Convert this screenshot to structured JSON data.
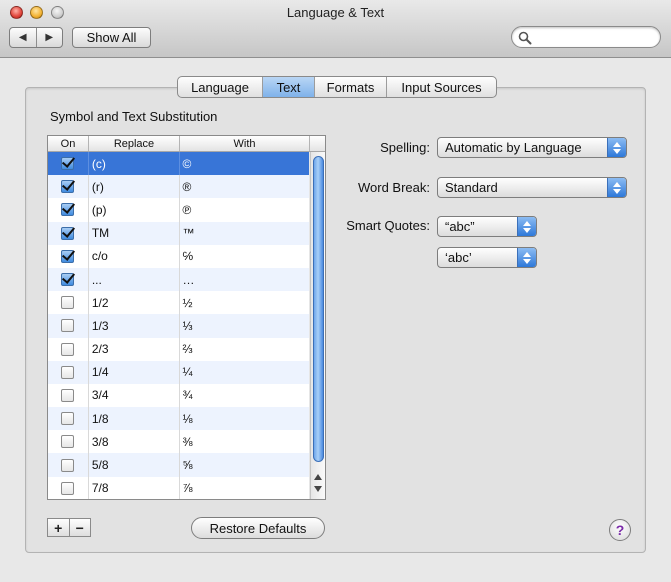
{
  "window": {
    "title": "Language & Text"
  },
  "toolbar": {
    "back_icon": "◀",
    "forward_icon": "▶",
    "show_all": "Show All",
    "search_placeholder": ""
  },
  "tabs": [
    {
      "label": "Language",
      "active": false
    },
    {
      "label": "Text",
      "active": true
    },
    {
      "label": "Formats",
      "active": false
    },
    {
      "label": "Input Sources",
      "active": false
    }
  ],
  "substitution": {
    "title": "Symbol and Text Substitution",
    "columns": {
      "on": "On",
      "replace": "Replace",
      "with": "With"
    },
    "rows": [
      {
        "on": true,
        "replace": "(c)",
        "with": "©",
        "selected": true
      },
      {
        "on": true,
        "replace": "(r)",
        "with": "®"
      },
      {
        "on": true,
        "replace": "(p)",
        "with": "℗"
      },
      {
        "on": true,
        "replace": "TM",
        "with": "™"
      },
      {
        "on": true,
        "replace": "c/o",
        "with": "℅"
      },
      {
        "on": true,
        "replace": "...",
        "with": "…"
      },
      {
        "on": false,
        "replace": "1/2",
        "with": "½"
      },
      {
        "on": false,
        "replace": "1/3",
        "with": "⅓"
      },
      {
        "on": false,
        "replace": "2/3",
        "with": "⅔"
      },
      {
        "on": false,
        "replace": "1/4",
        "with": "¼"
      },
      {
        "on": false,
        "replace": "3/4",
        "with": "¾"
      },
      {
        "on": false,
        "replace": "1/8",
        "with": "⅛"
      },
      {
        "on": false,
        "replace": "3/8",
        "with": "⅜"
      },
      {
        "on": false,
        "replace": "5/8",
        "with": "⅝"
      },
      {
        "on": false,
        "replace": "7/8",
        "with": "⅞"
      }
    ],
    "add_label": "+",
    "remove_label": "−",
    "restore_defaults": "Restore Defaults"
  },
  "options": {
    "spelling": {
      "label": "Spelling:",
      "value": "Automatic by Language"
    },
    "word_break": {
      "label": "Word Break:",
      "value": "Standard"
    },
    "smart_quotes": {
      "label": "Smart Quotes:",
      "double": "“abc”",
      "single": "‘abc’"
    }
  },
  "help": {
    "label": "?"
  },
  "colors": {
    "selection": "#3875d7",
    "accent": "#7fb2ea"
  }
}
